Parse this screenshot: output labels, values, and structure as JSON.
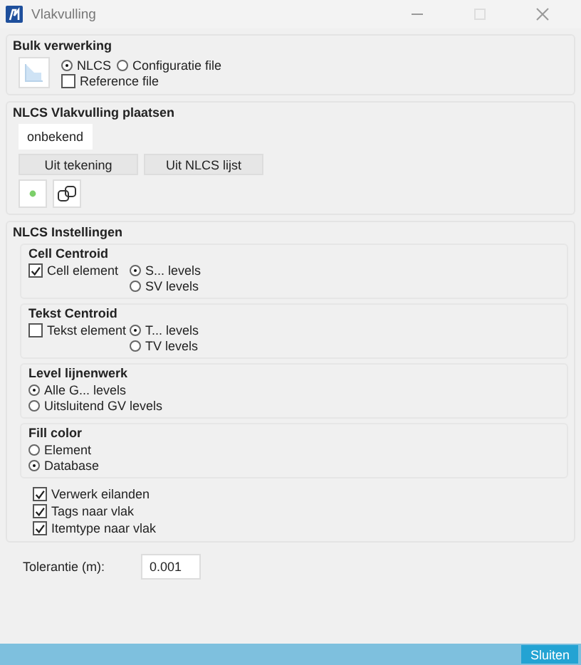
{
  "window": {
    "title": "Vlakvulling"
  },
  "bulk": {
    "title": "Bulk verwerking",
    "radios": [
      {
        "label": "NLCS",
        "selected": true
      },
      {
        "label": "Configuratie file",
        "selected": false
      }
    ],
    "checkbox": {
      "label": "Reference file",
      "checked": false
    }
  },
  "plaatsen": {
    "title": "NLCS Vlakvulling plaatsen",
    "value": "onbekend",
    "buttons": [
      "Uit tekening",
      "Uit NLCS lijst"
    ]
  },
  "instellingen": {
    "title": "NLCS Instellingen",
    "groups": [
      {
        "title": "Cell Centroid",
        "checkbox": {
          "label": "Cell element",
          "checked": true
        },
        "radios": [
          {
            "label": "S... levels",
            "selected": true
          },
          {
            "label": "SV levels",
            "selected": false
          }
        ]
      },
      {
        "title": "Tekst Centroid",
        "checkbox": {
          "label": "Tekst element",
          "checked": false
        },
        "radios": [
          {
            "label": "T... levels",
            "selected": true
          },
          {
            "label": "TV levels",
            "selected": false
          }
        ]
      },
      {
        "title": "Level lijnenwerk",
        "radios": [
          {
            "label": "Alle G... levels",
            "selected": true
          },
          {
            "label": "Uitsluitend GV levels",
            "selected": false
          }
        ]
      },
      {
        "title": "Fill color",
        "radios": [
          {
            "label": "Element",
            "selected": false
          },
          {
            "label": "Database",
            "selected": true
          }
        ]
      }
    ],
    "checks": [
      {
        "label": "Verwerk eilanden",
        "checked": true
      },
      {
        "label": "Tags naar vlak",
        "checked": true
      },
      {
        "label": "Itemtype naar vlak",
        "checked": true
      }
    ]
  },
  "tolerance": {
    "label": "Tolerantie (m):",
    "value": "0.001"
  },
  "footer": {
    "button": "Sluiten"
  }
}
